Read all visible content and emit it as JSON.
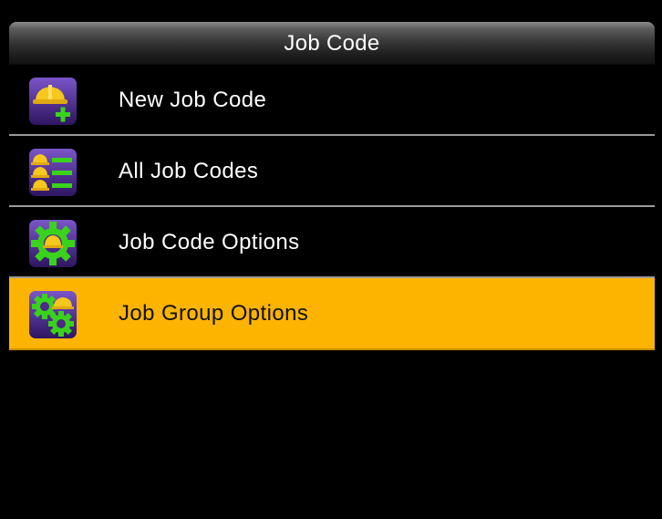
{
  "header": {
    "title": "Job Code"
  },
  "menu": {
    "items": [
      {
        "label": "New Job Code",
        "icon": "new-job-code-icon",
        "selected": false
      },
      {
        "label": "All Job Codes",
        "icon": "all-job-codes-icon",
        "selected": false
      },
      {
        "label": "Job Code Options",
        "icon": "job-code-options-icon",
        "selected": false
      },
      {
        "label": "Job Group Options",
        "icon": "job-group-options-icon",
        "selected": true
      }
    ]
  },
  "colors": {
    "background": "#000000",
    "selected_row": "#fdb400",
    "divider": "#9a9a9a",
    "icon_purple": "#4a2a86",
    "icon_yellow": "#f6c71c",
    "icon_green": "#3ad21c"
  }
}
